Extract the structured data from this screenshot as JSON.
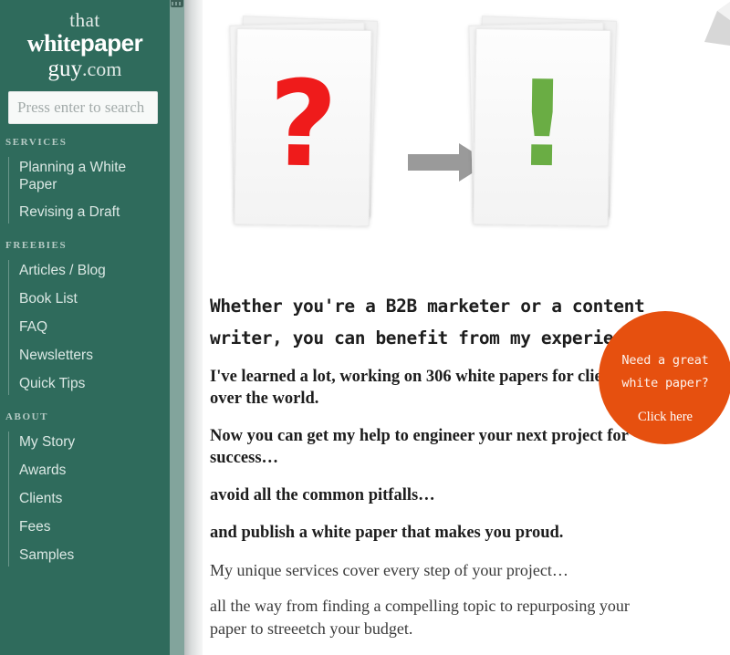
{
  "sidebar": {
    "logo": {
      "line1": "that",
      "white": "white",
      "paper": "paper",
      "guy": "guy",
      "com": ".com"
    },
    "search": {
      "placeholder": "Press enter to search",
      "value": ""
    },
    "groups": [
      {
        "heading": "SERVICES",
        "items": [
          {
            "label": "Planning a White Paper"
          },
          {
            "label": "Revising a Draft"
          }
        ]
      },
      {
        "heading": "FREEBIES",
        "items": [
          {
            "label": "Articles / Blog"
          },
          {
            "label": "Book List"
          },
          {
            "label": "FAQ"
          },
          {
            "label": "Newsletters"
          },
          {
            "label": "Quick Tips"
          }
        ]
      },
      {
        "heading": "ABOUT",
        "items": [
          {
            "label": "My Story"
          },
          {
            "label": "Awards"
          },
          {
            "label": "Clients"
          },
          {
            "label": "Fees"
          },
          {
            "label": "Samples"
          }
        ]
      }
    ]
  },
  "hero": {
    "question_glyph": "?",
    "exclamation_glyph": "!",
    "arrow": "arrow-right-icon"
  },
  "main": {
    "headline": "Whether you're a B2B marketer or a content writer, you can benefit from my experience.",
    "lead_paragraphs": [
      "I've learned a lot, working on 306 white papers for clients all over the world.",
      "Now you can get my help to engineer your next project for success…",
      "avoid all the common pitfalls…",
      "and publish a white paper that makes you proud."
    ],
    "body_paragraphs": [
      "My unique services cover every step of your project…",
      "all the way from finding a compelling topic to repurposing your paper to streeetch your budget."
    ]
  },
  "badge": {
    "line1": "Need a great",
    "line2": "white paper?",
    "cta": "Click here"
  },
  "colors": {
    "sidebar_green": "#2F6B5C",
    "sidebar_edge_green": "#82A49C",
    "badge_orange": "#E6500F",
    "question_red": "#EF1B1B",
    "exclamation_green": "#6AAD44",
    "arrow_gray": "#9A9A9A"
  }
}
